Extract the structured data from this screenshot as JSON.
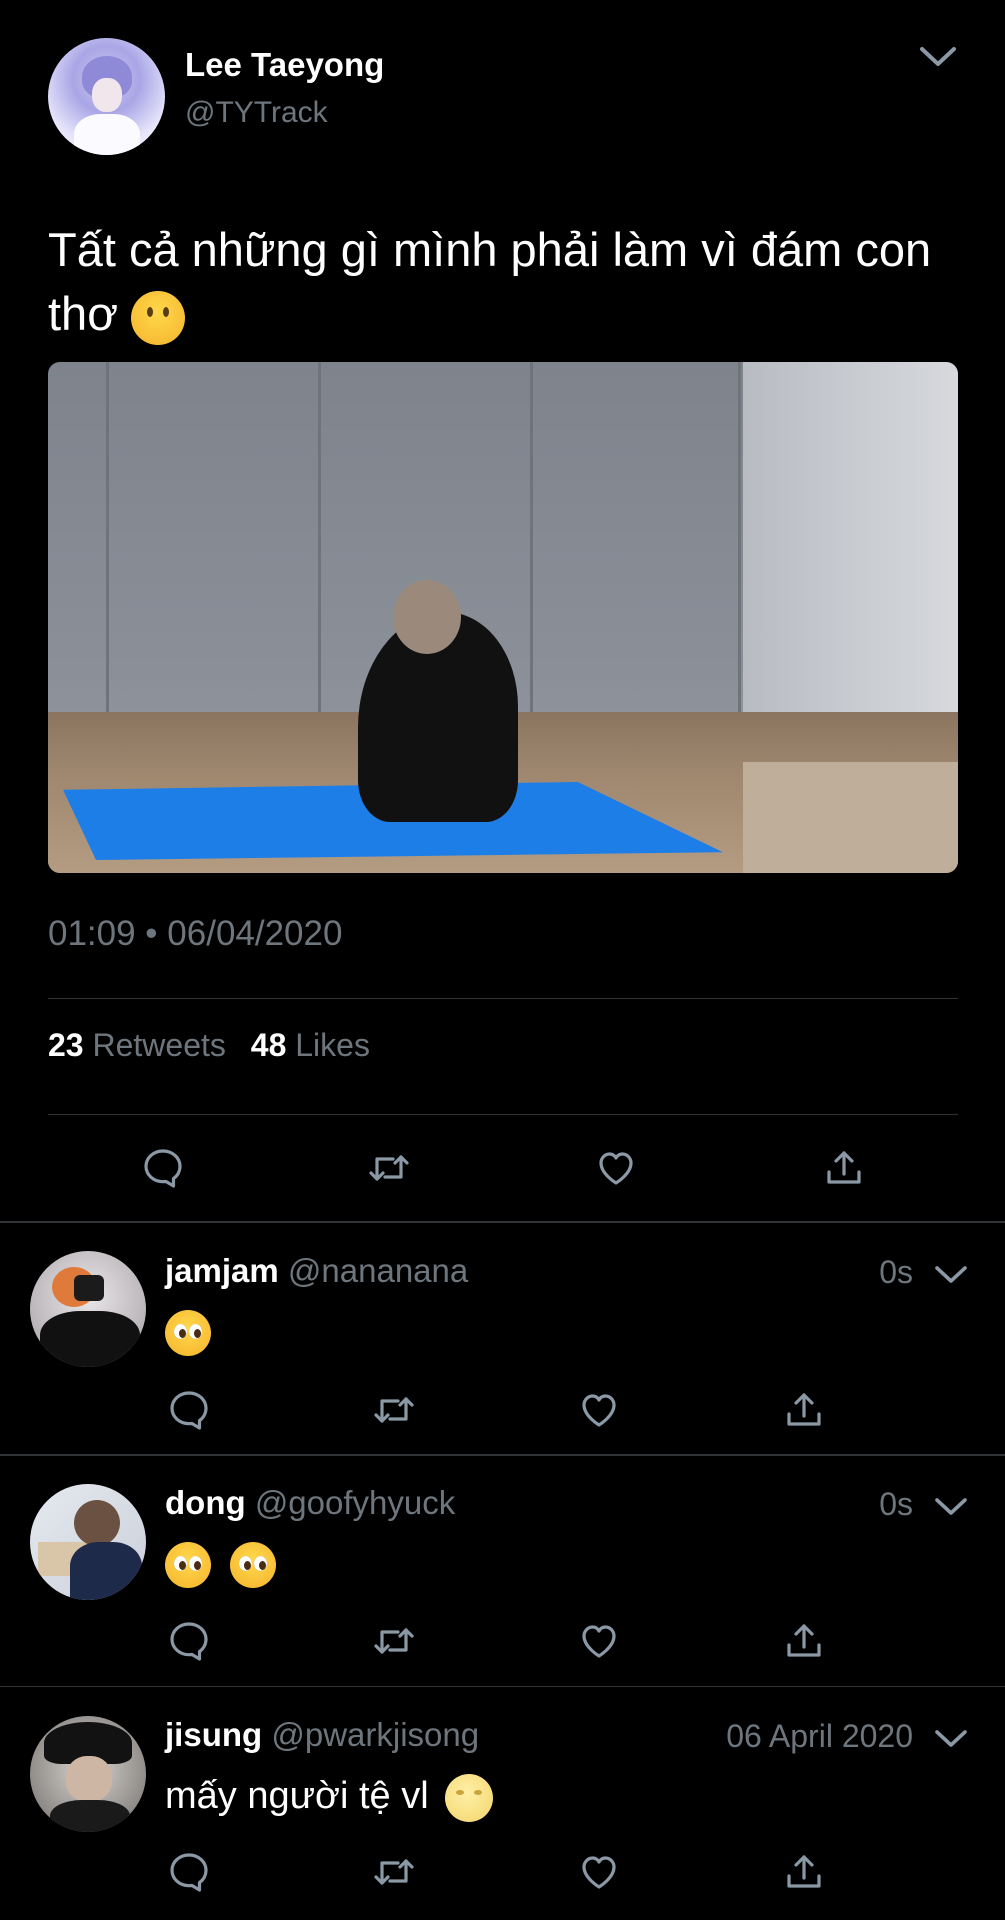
{
  "tweet": {
    "author_name": "Lee Taeyong",
    "author_handle": "@TYTrack",
    "text": "Tất cả những gì mình phải làm vì đám con thơ",
    "timestamp": "01:09 • 06/04/2020",
    "retweet_count": "23",
    "retweet_label": "Retweets",
    "like_count": "48",
    "like_label": "Likes"
  },
  "replies": [
    {
      "name": "jamjam",
      "handle": "@nananana",
      "time": "0s",
      "emojis": [
        "pleading-face"
      ]
    },
    {
      "name": "dong",
      "handle": "@goofyhyuck",
      "time": "0s",
      "emojis": [
        "pleading-face",
        "pleading-face"
      ]
    },
    {
      "name": "jisung",
      "handle": "@pwarkjisong",
      "time": "06 April 2020",
      "text": "mấy người tệ vl",
      "emojis": [
        "moon-face"
      ]
    }
  ],
  "colors": {
    "background": "#000000",
    "secondary_text": "#6e767d",
    "divider": "#2f3336",
    "icon": "#8b98a5"
  }
}
